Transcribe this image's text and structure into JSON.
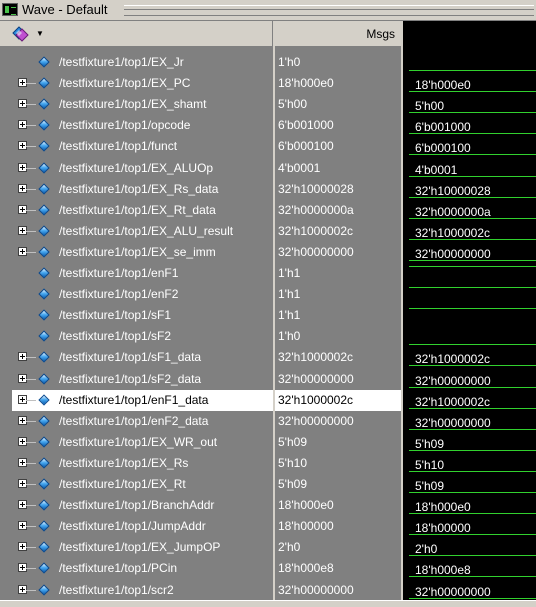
{
  "window": {
    "title": "Wave - Default"
  },
  "header": {
    "msgs_label": "Msgs"
  },
  "colors": {
    "wave_bg": "#000000",
    "wave_line": "#31d12e",
    "panel_bg": "#808080",
    "selection_bg": "#ffffff"
  },
  "selected_index": 16,
  "signals": [
    {
      "name": "/testfixture1/top1/EX_Jr",
      "value": "1'h0",
      "expandable": false,
      "wave": "",
      "level": "low"
    },
    {
      "name": "/testfixture1/top1/EX_PC",
      "value": "18'h000e0",
      "expandable": true,
      "wave": "18'h000e0",
      "level": "bus"
    },
    {
      "name": "/testfixture1/top1/EX_shamt",
      "value": "5'h00",
      "expandable": true,
      "wave": "5'h00",
      "level": "bus"
    },
    {
      "name": "/testfixture1/top1/opcode",
      "value": "6'b001000",
      "expandable": true,
      "wave": "6'b001000",
      "level": "bus"
    },
    {
      "name": "/testfixture1/top1/funct",
      "value": "6'b000100",
      "expandable": true,
      "wave": "6'b000100",
      "level": "bus"
    },
    {
      "name": "/testfixture1/top1/EX_ALUOp",
      "value": "4'b0001",
      "expandable": true,
      "wave": "4'b0001",
      "level": "bus"
    },
    {
      "name": "/testfixture1/top1/EX_Rs_data",
      "value": "32'h10000028",
      "expandable": true,
      "wave": "32'h10000028",
      "level": "bus"
    },
    {
      "name": "/testfixture1/top1/EX_Rt_data",
      "value": "32'h0000000a",
      "expandable": true,
      "wave": "32'h0000000a",
      "level": "bus"
    },
    {
      "name": "/testfixture1/top1/EX_ALU_result",
      "value": "32'h1000002c",
      "expandable": true,
      "wave": "32'h1000002c",
      "level": "bus"
    },
    {
      "name": "/testfixture1/top1/EX_se_imm",
      "value": "32'h00000000",
      "expandable": true,
      "wave": "32'h00000000",
      "level": "bus"
    },
    {
      "name": "/testfixture1/top1/enF1",
      "value": "1'h1",
      "expandable": false,
      "wave": "",
      "level": "high"
    },
    {
      "name": "/testfixture1/top1/enF2",
      "value": "1'h1",
      "expandable": false,
      "wave": "",
      "level": "high"
    },
    {
      "name": "/testfixture1/top1/sF1",
      "value": "1'h1",
      "expandable": false,
      "wave": "",
      "level": "high"
    },
    {
      "name": "/testfixture1/top1/sF2",
      "value": "1'h0",
      "expandable": false,
      "wave": "",
      "level": "low"
    },
    {
      "name": "/testfixture1/top1/sF1_data",
      "value": "32'h1000002c",
      "expandable": true,
      "wave": "32'h1000002c",
      "level": "bus"
    },
    {
      "name": "/testfixture1/top1/sF2_data",
      "value": "32'h00000000",
      "expandable": true,
      "wave": "32'h00000000",
      "level": "bus"
    },
    {
      "name": "/testfixture1/top1/enF1_data",
      "value": "32'h1000002c",
      "expandable": true,
      "wave": "32'h1000002c",
      "level": "bus"
    },
    {
      "name": "/testfixture1/top1/enF2_data",
      "value": "32'h00000000",
      "expandable": true,
      "wave": "32'h00000000",
      "level": "bus"
    },
    {
      "name": "/testfixture1/top1/EX_WR_out",
      "value": "5'h09",
      "expandable": true,
      "wave": "5'h09",
      "level": "bus"
    },
    {
      "name": "/testfixture1/top1/EX_Rs",
      "value": "5'h10",
      "expandable": true,
      "wave": "5'h10",
      "level": "bus"
    },
    {
      "name": "/testfixture1/top1/EX_Rt",
      "value": "5'h09",
      "expandable": true,
      "wave": "5'h09",
      "level": "bus"
    },
    {
      "name": "/testfixture1/top1/BranchAddr",
      "value": "18'h000e0",
      "expandable": true,
      "wave": "18'h000e0",
      "level": "bus"
    },
    {
      "name": "/testfixture1/top1/JumpAddr",
      "value": "18'h00000",
      "expandable": true,
      "wave": "18'h00000",
      "level": "bus"
    },
    {
      "name": "/testfixture1/top1/EX_JumpOP",
      "value": "2'h0",
      "expandable": true,
      "wave": "2'h0",
      "level": "bus"
    },
    {
      "name": "/testfixture1/top1/PCin",
      "value": "18'h000e8",
      "expandable": true,
      "wave": "18'h000e8",
      "level": "bus"
    },
    {
      "name": "/testfixture1/top1/scr2",
      "value": "32'h00000000",
      "expandable": true,
      "wave": "32'h00000000",
      "level": "bus"
    }
  ]
}
